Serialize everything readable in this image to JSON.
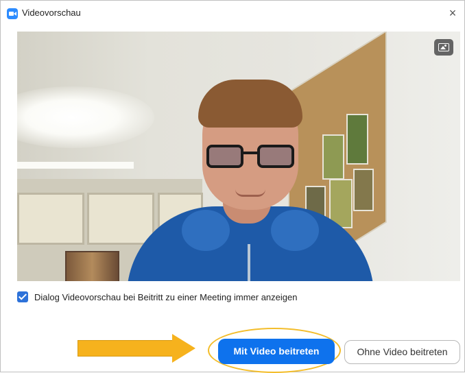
{
  "window": {
    "title": "Videovorschau",
    "close_glyph": "×"
  },
  "preview": {
    "background_toggle_icon": "image-icon"
  },
  "options": {
    "always_show_preview_label": "Dialog Videovorschau bei Beitritt zu einer Meeting immer anzeigen",
    "always_show_preview_checked": true
  },
  "actions": {
    "join_with_video_label": "Mit Video beitreten",
    "join_without_video_label": "Ohne Video beitreten"
  },
  "colors": {
    "accent": "#0e72ed",
    "checkbox": "#2d72d9",
    "annotation": "#f6b21d"
  }
}
